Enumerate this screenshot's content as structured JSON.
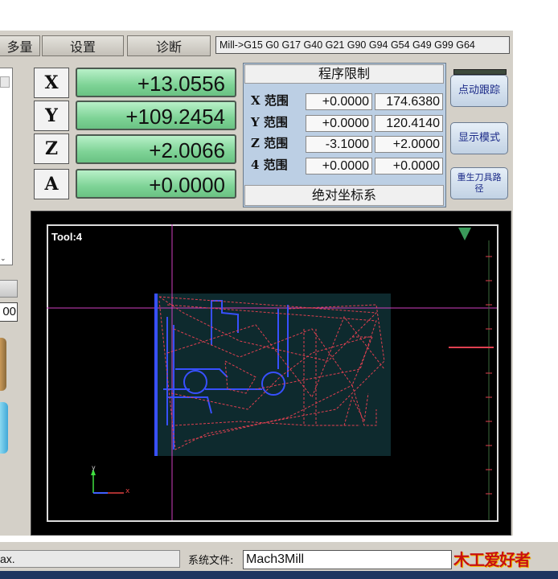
{
  "tabs": {
    "offsets": "多量",
    "settings": "设置",
    "diagnostics": "诊断"
  },
  "gcode_state": "Mill->G15  G0 G17 G40 G21 G90 G94 G54 G49 G99 G64",
  "axes": [
    {
      "label": "X",
      "value": "+13.0556"
    },
    {
      "label": "Y",
      "value": "+109.2454"
    },
    {
      "label": "Z",
      "value": "+2.0066"
    },
    {
      "label": "A",
      "value": "+0.0000"
    }
  ],
  "limits": {
    "title": "程序限制",
    "rows": [
      {
        "label": "X 范围",
        "min": "+0.0000",
        "max": "174.6380"
      },
      {
        "label": "Y 范围",
        "min": "+0.0000",
        "max": "120.4140"
      },
      {
        "label": "Z 范围",
        "min": "-3.1000",
        "max": "+2.0000"
      },
      {
        "label": "4 范围",
        "min": "+0.0000",
        "max": "+0.0000"
      }
    ],
    "footer": "绝对坐标系"
  },
  "side_buttons": {
    "jog_follow": "点动跟踪",
    "display_mode": "显示模式",
    "regen_toolpath": "重生刀具路径"
  },
  "toolpath": {
    "tool_label": "Tool:4",
    "axis_x_label": "x",
    "axis_y_label": "y"
  },
  "left_partial": {
    "value": "00"
  },
  "status": {
    "left_text": "ax.",
    "profile_label": "系统文件:",
    "profile_value": "Mach3Mill"
  },
  "watermark": "木工爱好者",
  "colors": {
    "dro_green": "#7ed396",
    "limits_blue": "#bccfe4",
    "toolpath_bg": "#000000",
    "crosshair": "#d040c0",
    "path_red": "#e04050",
    "path_blue": "#3850ff"
  }
}
